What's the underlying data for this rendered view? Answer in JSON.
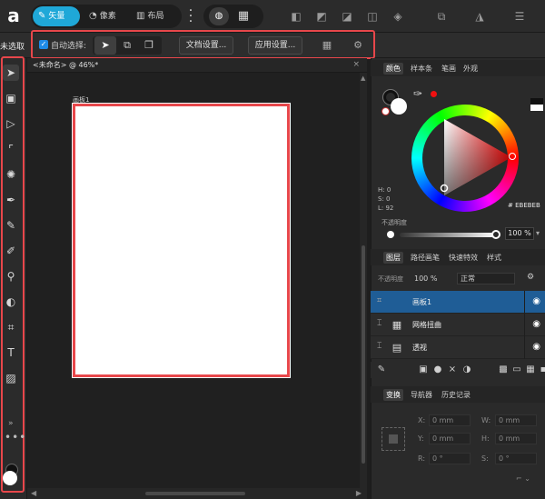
{
  "topbar": {
    "logo": "a",
    "personas": [
      {
        "label": "矢量",
        "icon": "vector-persona-icon",
        "glyph": "✎",
        "active": true
      },
      {
        "label": "像素",
        "icon": "pixel-persona-icon",
        "glyph": "◔",
        "active": false
      },
      {
        "label": "布局",
        "icon": "layout-persona-icon",
        "glyph": "▥",
        "active": false
      }
    ]
  },
  "context_toolbar": {
    "selection_status": "未选取",
    "auto_select_label": "自动选择:",
    "auto_select_checked": true,
    "document_setup_label": "文档设置...",
    "preferences_label": "应用设置..."
  },
  "document": {
    "tab_title": "<未命名> @ 46%*",
    "artboard_name": "画板1"
  },
  "color_panel": {
    "tabs": [
      "颜色",
      "样本条",
      "笔画",
      "外观"
    ],
    "active_tab": 0,
    "h": "H: 0",
    "s": "S: 0",
    "l": "L: 92",
    "hex": "# EBEBEB",
    "opacity_label": "不透明度",
    "opacity_value": "100 %",
    "opacity_fraction": 1.0,
    "fill_color": "#FFFFFF",
    "accent_red": "#F01010"
  },
  "layers_panel": {
    "tabs": [
      "图层",
      "路径画笔",
      "快速特效",
      "样式"
    ],
    "active_tab": 0,
    "opacity_label": "不透明度",
    "opacity_value": "100 %",
    "blend_mode": "正常",
    "layers": [
      {
        "name": "画板1",
        "icon": "artboard-icon",
        "selected": true
      },
      {
        "name": "网格扭曲",
        "icon": "mesh-warp-icon",
        "selected": false
      },
      {
        "name": "透视",
        "icon": "perspective-icon",
        "selected": false
      }
    ]
  },
  "transform_panel": {
    "tabs": [
      "变换",
      "导航器",
      "历史记录"
    ],
    "active_tab": 0,
    "x": "0 mm",
    "y": "0 mm",
    "w": "0 mm",
    "h": "0 mm",
    "r": "0 °",
    "s": "0 °",
    "x_label": "X:",
    "y_label": "Y:",
    "w_label": "W:",
    "h_label": "H:",
    "r_label": "R:",
    "s_label": "S:"
  },
  "highlight_color": "#E8474B",
  "accent_color": "#1FA8D8"
}
